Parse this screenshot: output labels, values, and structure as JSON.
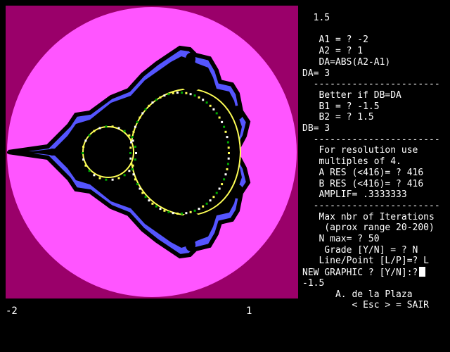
{
  "terminal": {
    "lines": [
      "  1.5",
      "",
      "   A1 = ? -2",
      "   A2 = ? 1",
      "   DA=ABS(A2-A1)",
      "DA= 3",
      "  -----------------------",
      "   Better if DB=DA",
      "   B1 = ? -1.5",
      "   B2 = ? 1.5",
      "DB= 3",
      "  -----------------------",
      "   For resolution use",
      "   multiples of 4.",
      "   A RES (<416)= ? 416",
      "   B RES (<416)= ? 416",
      "   AMPLIF= .3333333",
      "  -----------------------",
      "   Max nbr of Iterations",
      "    (aprox range 20-200)",
      "   N max= ? 50",
      "    Grade [Y/N] = ? N",
      "   Line/Point [L/P]=? L",
      "NEW GRAPHIC ? [Y/N]:?",
      "-1.5",
      "      A. de la Plaza",
      "         < Esc > = SAIR"
    ]
  },
  "axis": {
    "x_min_label": "-2",
    "x_max_label": "1"
  },
  "colors": {
    "outer_background": "#9a006a",
    "escape_disc": "#ff55ff",
    "set_interior": "#000000",
    "band_blue": "#5555ff",
    "band_green": "#00aa00",
    "band_yellow": "#ffff55",
    "band_white": "#ffffff"
  }
}
